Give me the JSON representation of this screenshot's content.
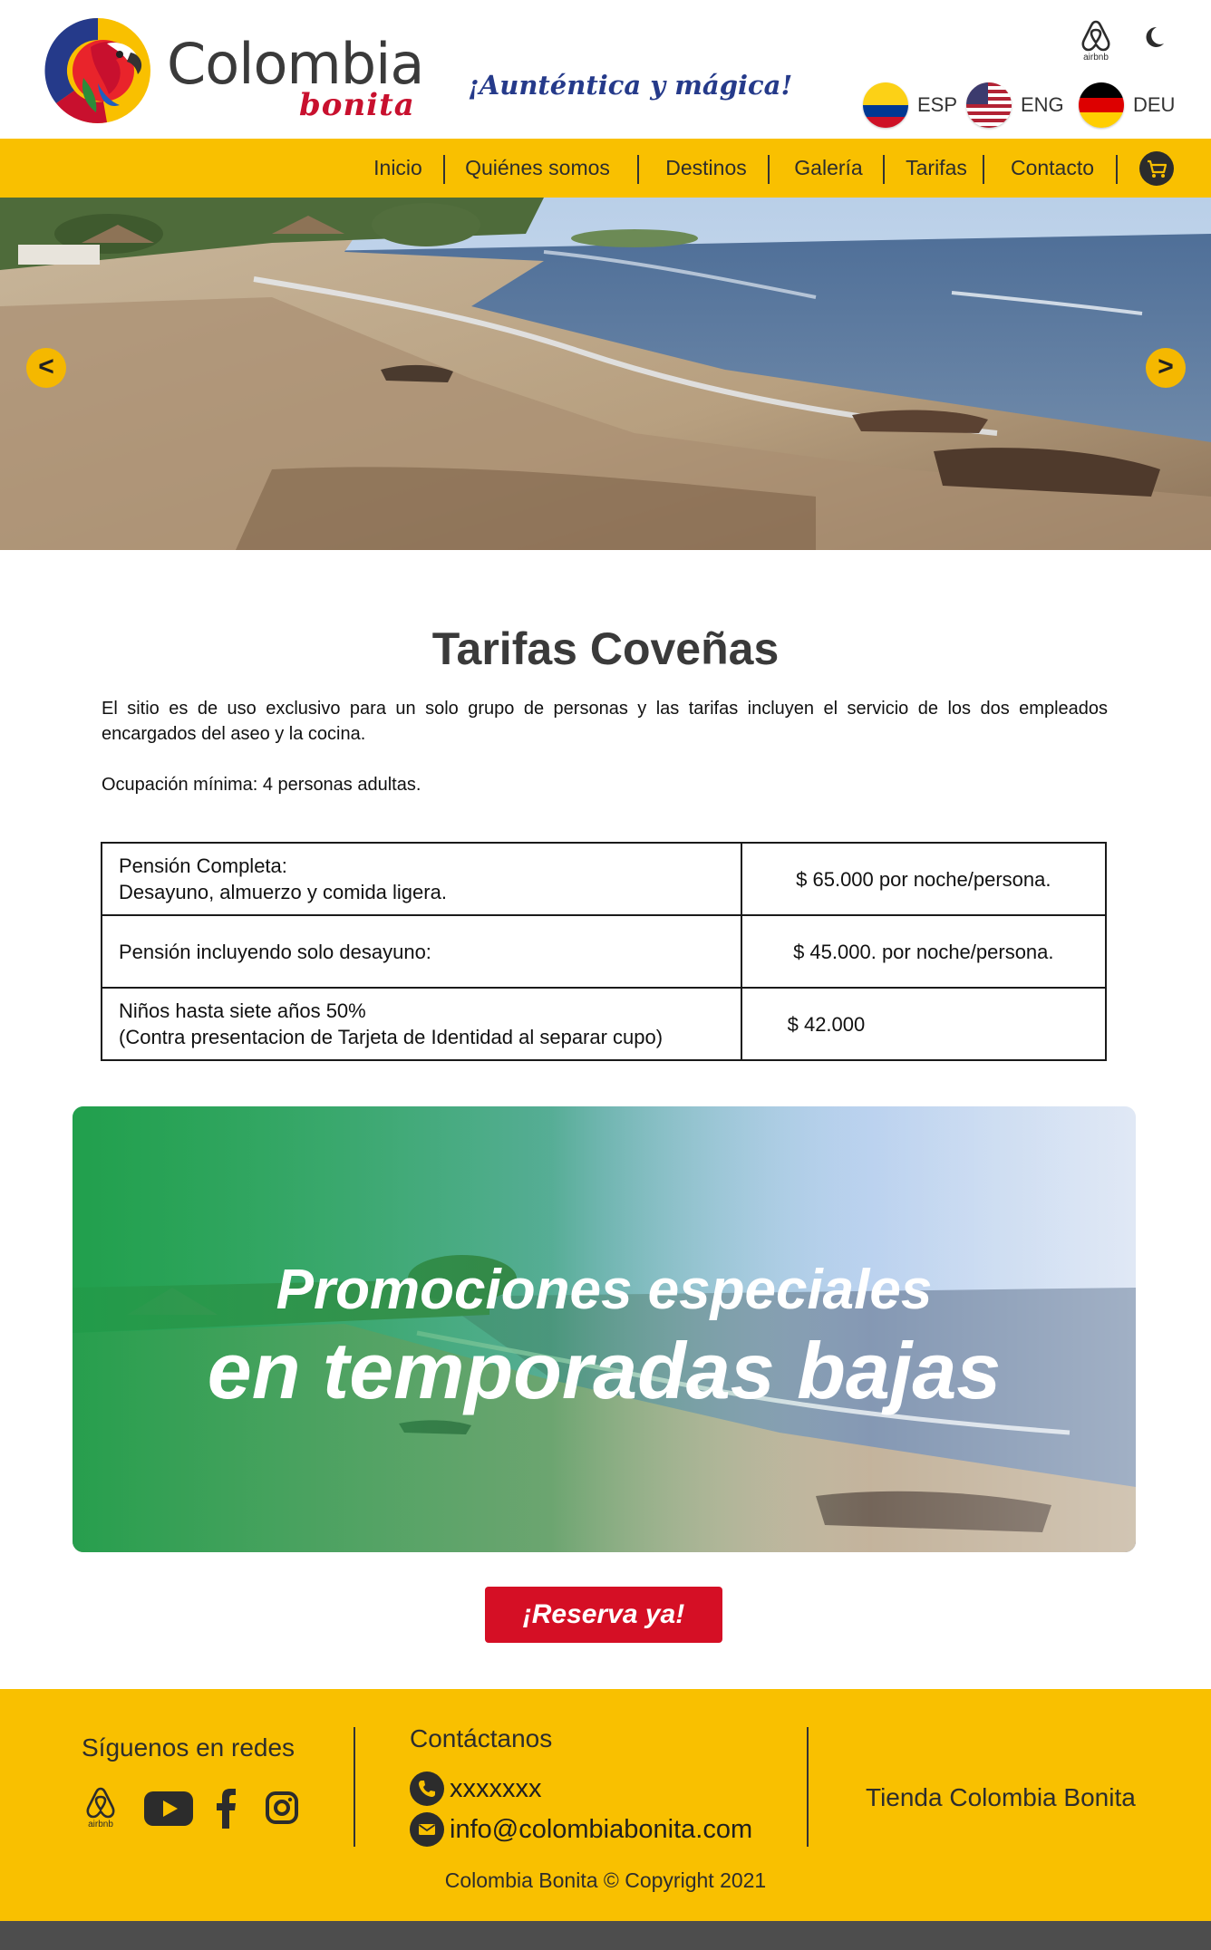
{
  "header": {
    "logo_word": "Colombia",
    "logo_sub": "bonita",
    "tagline": "¡Aunténtica y mágica!",
    "airbnb_label": "airbnb",
    "languages": [
      {
        "code": "ESP",
        "icon": "colombia-flag-icon"
      },
      {
        "code": "ENG",
        "icon": "usa-flag-icon"
      },
      {
        "code": "DEU",
        "icon": "germany-flag-icon"
      }
    ]
  },
  "nav": {
    "items": [
      "Inicio",
      "Quiénes somos",
      "Destinos",
      "Galería",
      "Tarifas",
      "Contacto"
    ],
    "cart_icon": "cart-icon"
  },
  "hero": {
    "prev_label": "<",
    "next_label": ">"
  },
  "content": {
    "title": "Tarifas Coveñas",
    "intro": "El sitio es de uso exclusivo para un solo grupo de personas y las tarifas incluyen el servicio de los dos empleados encargados del aseo y la cocina.",
    "occupancy": "Ocupación mínima: 4 personas adultas.",
    "rates": [
      {
        "line1": "Pensión Completa:",
        "line2": "Desayuno, almuerzo y comida ligera.",
        "price": "$ 65.000 por noche/persona."
      },
      {
        "line1": "Pensión incluyendo solo desayuno:",
        "line2": "",
        "price": "$ 45.000. por noche/persona."
      },
      {
        "line1": "Niños hasta siete años 50%",
        "line2": "(Contra presentacion de Tarjeta de Identidad al separar cupo)",
        "price": "$ 42.000"
      }
    ]
  },
  "promo": {
    "line1": "Promociones especiales",
    "line2": "en temporadas bajas"
  },
  "reserve_label": "¡Reserva ya!",
  "footer": {
    "social_heading": "Síguenos en redes",
    "social_icons": [
      "airbnb-icon",
      "youtube-icon",
      "facebook-icon",
      "instagram-icon"
    ],
    "airbnb_label": "airbnb",
    "contact_heading": "Contáctanos",
    "phone": "xxxxxxx",
    "email": "info@colombiabonita.com",
    "store": "Tienda Colombia Bonita",
    "copyright": "Colombia Bonita © Copyright 2021"
  },
  "colors": {
    "brand_yellow": "#f9c000",
    "brand_red": "#d50f25",
    "brand_blue": "#253a8a",
    "footer_bar": "#4d4d4d"
  }
}
